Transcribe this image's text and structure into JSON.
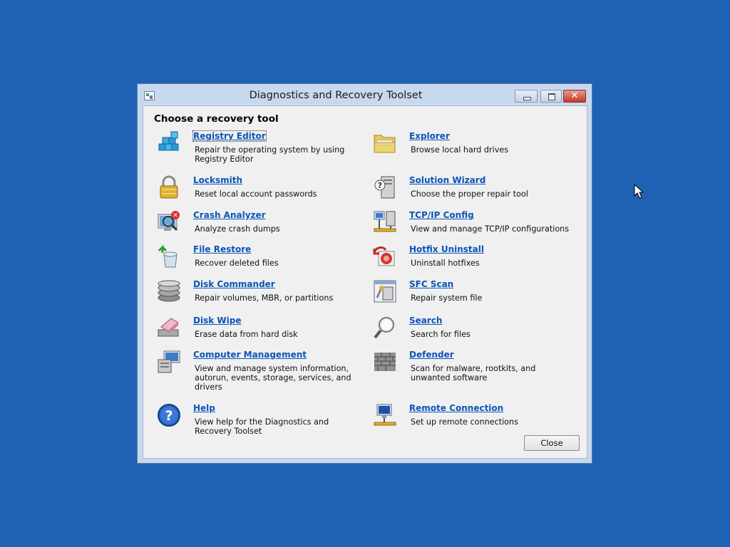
{
  "window": {
    "title": "Diagnostics and Recovery Toolset"
  },
  "heading": "Choose a recovery tool",
  "left_tools": [
    {
      "name": "Registry Editor",
      "desc": "Repair the operating system by using Registry Editor",
      "icon": "registry-editor-icon"
    },
    {
      "name": "Locksmith",
      "desc": "Reset local account passwords",
      "icon": "padlock-icon"
    },
    {
      "name": "Crash Analyzer",
      "desc": "Analyze crash dumps",
      "icon": "crash-analyzer-icon"
    },
    {
      "name": "File Restore",
      "desc": "Recover deleted files",
      "icon": "recycle-bin-restore-icon"
    },
    {
      "name": "Disk Commander",
      "desc": "Repair volumes, MBR, or partitions",
      "icon": "disk-stack-icon"
    },
    {
      "name": "Disk Wipe",
      "desc": "Erase data from hard disk",
      "icon": "eraser-disk-icon"
    },
    {
      "name": "Computer Management",
      "desc": "View and manage system information, autorun, events, storage, services, and drivers",
      "icon": "computer-management-icon"
    },
    {
      "name": "Help",
      "desc": "View help for the Diagnostics and Recovery Toolset",
      "icon": "help-icon"
    }
  ],
  "right_tools": [
    {
      "name": "Explorer",
      "desc": "Browse local hard drives",
      "icon": "folder-icon"
    },
    {
      "name": "Solution Wizard",
      "desc": "Choose the proper repair tool",
      "icon": "solution-wizard-icon"
    },
    {
      "name": "TCP/IP Config",
      "desc": "View and manage TCP/IP configurations",
      "icon": "network-config-icon"
    },
    {
      "name": "Hotfix Uninstall",
      "desc": "Uninstall hotfixes",
      "icon": "hotfix-uninstall-icon"
    },
    {
      "name": "SFC Scan",
      "desc": "Repair system file",
      "icon": "sfc-scan-icon"
    },
    {
      "name": "Search",
      "desc": "Search for files",
      "icon": "magnifier-icon"
    },
    {
      "name": "Defender",
      "desc": "Scan for malware, rootkits, and unwanted software",
      "icon": "brick-wall-icon"
    },
    {
      "name": "Remote Connection",
      "desc": "Set up remote connections",
      "icon": "remote-connection-icon"
    }
  ],
  "close_label": "Close",
  "colors": {
    "desktop": "#1f62b4",
    "link": "#0a55b8",
    "window_frame": "#c8d8ee"
  }
}
